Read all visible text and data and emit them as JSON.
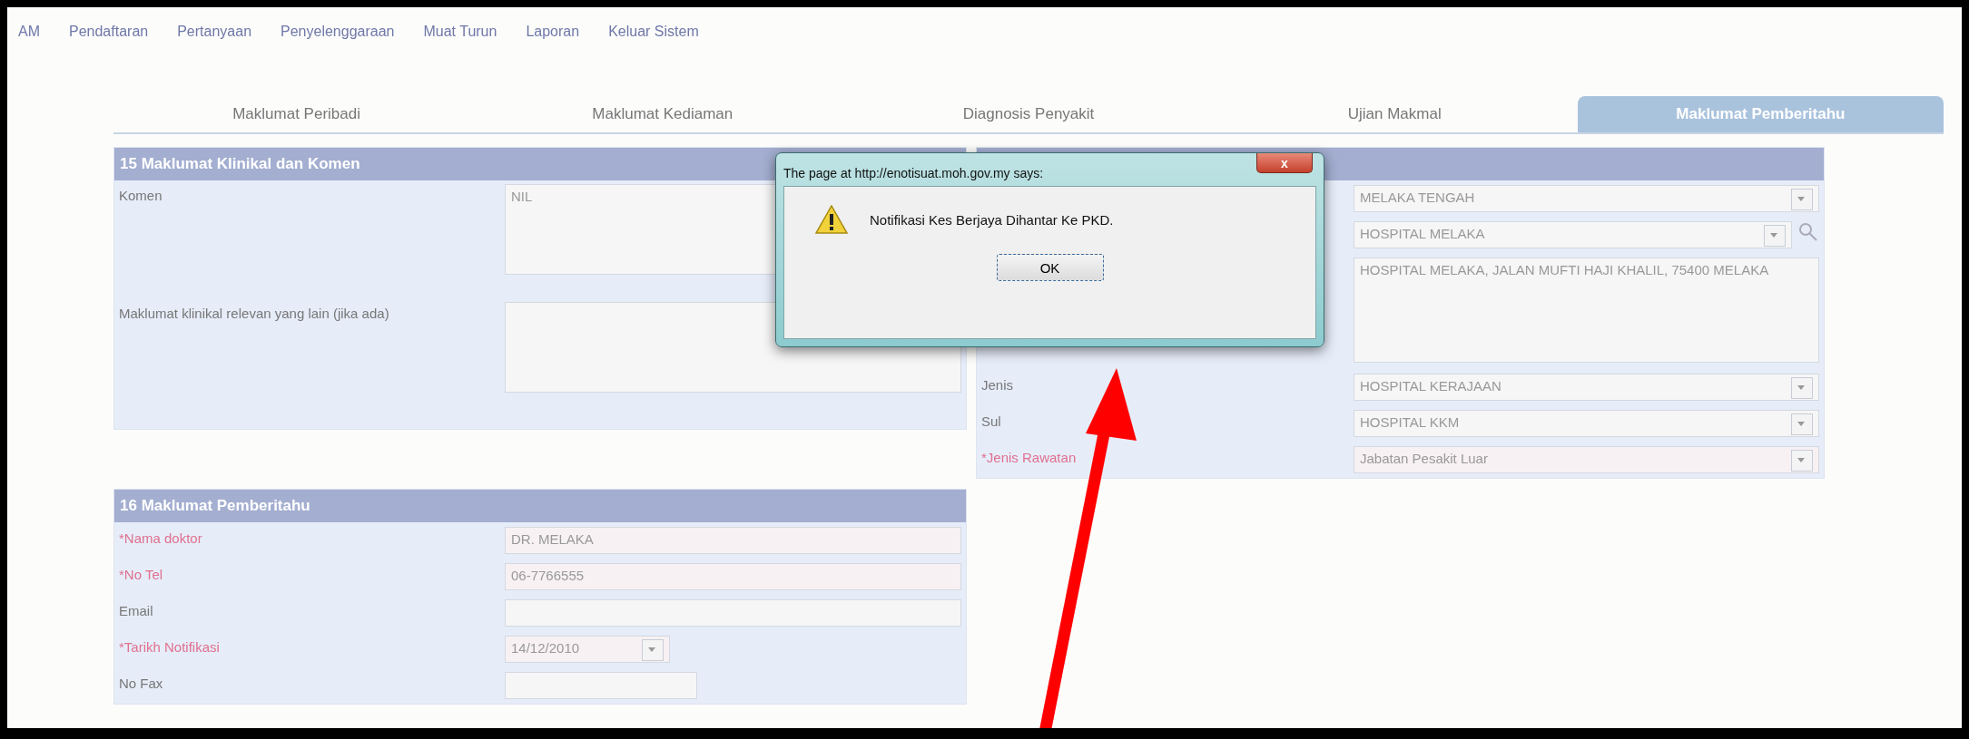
{
  "nav": [
    "AM",
    "Pendaftaran",
    "Pertanyaan",
    "Penyelenggaraan",
    "Muat Turun",
    "Laporan",
    "Keluar Sistem"
  ],
  "tabs": [
    {
      "label": "Maklumat Peribadi",
      "selected": false
    },
    {
      "label": "Maklumat Kediaman",
      "selected": false
    },
    {
      "label": "Diagnosis Penyakit",
      "selected": false
    },
    {
      "label": "Ujian Makmal",
      "selected": false
    },
    {
      "label": "Maklumat Pemberitahu",
      "selected": true
    }
  ],
  "section_15": {
    "title": "15 Maklumat Klinikal dan Komen",
    "fields": [
      {
        "label": "Komen",
        "value": "NIL"
      },
      {
        "label": "Maklumat klinikal relevan yang lain (jika ada)"
      }
    ]
  },
  "location_panel": {
    "fields": [
      {
        "kind": "select",
        "value": "MELAKA TENGAH"
      },
      {
        "kind": "lookup",
        "value": "HOSPITAL MELAKA"
      },
      {
        "kind": "textarea",
        "value": "HOSPITAL MELAKA, JALAN MUFTI HAJI KHALIL, 75400 MELAKA"
      },
      {
        "kind": "select",
        "label": "Jenis",
        "required": false,
        "value": "HOSPITAL KERAJAAN"
      },
      {
        "kind": "select",
        "label": "Sul",
        "required": false,
        "value": "HOSPITAL KKM"
      },
      {
        "kind": "select",
        "label": "*Jenis Rawatan",
        "required": true,
        "value": "Jabatan Pesakit Luar"
      }
    ]
  },
  "section_16": {
    "title": "16 Maklumat Pemberitahu",
    "fields": [
      {
        "kind": "text",
        "label": "*Nama doktor",
        "required": true,
        "value": "DR. MELAKA"
      },
      {
        "kind": "text",
        "label": "*No Tel",
        "required": true,
        "value": "06-7766555"
      },
      {
        "kind": "text",
        "label": "Email",
        "required": false
      },
      {
        "kind": "date",
        "label": "*Tarikh Notifikasi",
        "required": true,
        "value": "14/12/2010"
      },
      {
        "kind": "short",
        "label": "No Fax",
        "required": false
      }
    ]
  },
  "dialog": {
    "title": "The page at http://enotisuat.moh.gov.my says:",
    "close": "x",
    "message": "Notifikasi Kes Berjaya Dihantar Ke PKD.",
    "button": "OK"
  },
  "annotation": {
    "kind": "arrow"
  }
}
